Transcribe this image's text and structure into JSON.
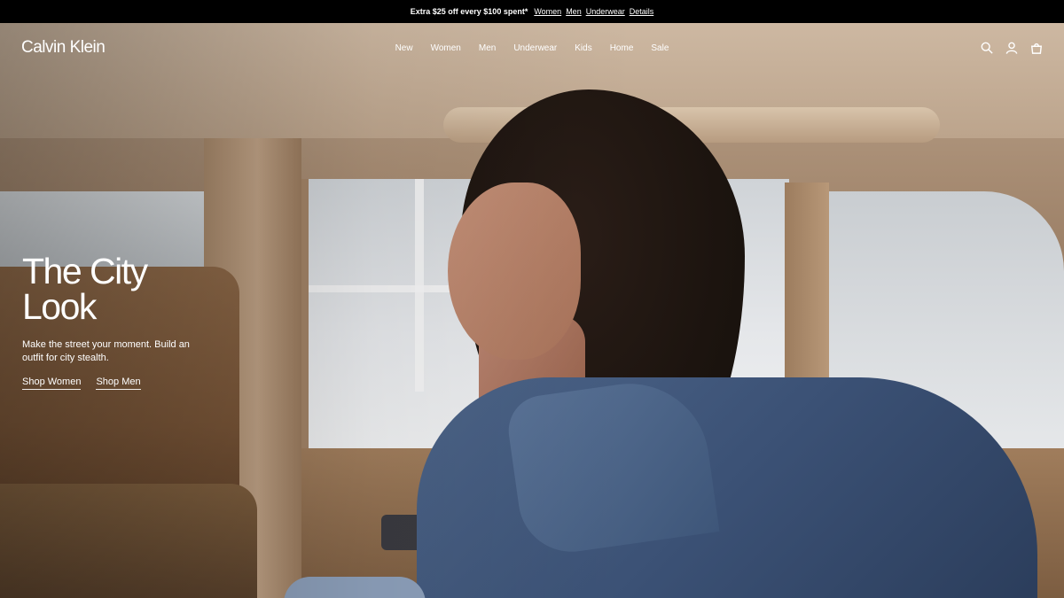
{
  "promo": {
    "text": "Extra $25 off every $100 spent*",
    "links": [
      "Women",
      "Men",
      "Underwear",
      "Details"
    ]
  },
  "header": {
    "logo": "Calvin Klein",
    "nav": [
      "New",
      "Women",
      "Men",
      "Underwear",
      "Kids",
      "Home",
      "Sale"
    ],
    "icons": [
      "search-icon",
      "account-icon",
      "bag-icon"
    ]
  },
  "hero": {
    "title": "The City Look",
    "subtitle": "Make the street your moment. Build an outfit for city stealth.",
    "ctas": [
      "Shop Women",
      "Shop Men"
    ]
  }
}
